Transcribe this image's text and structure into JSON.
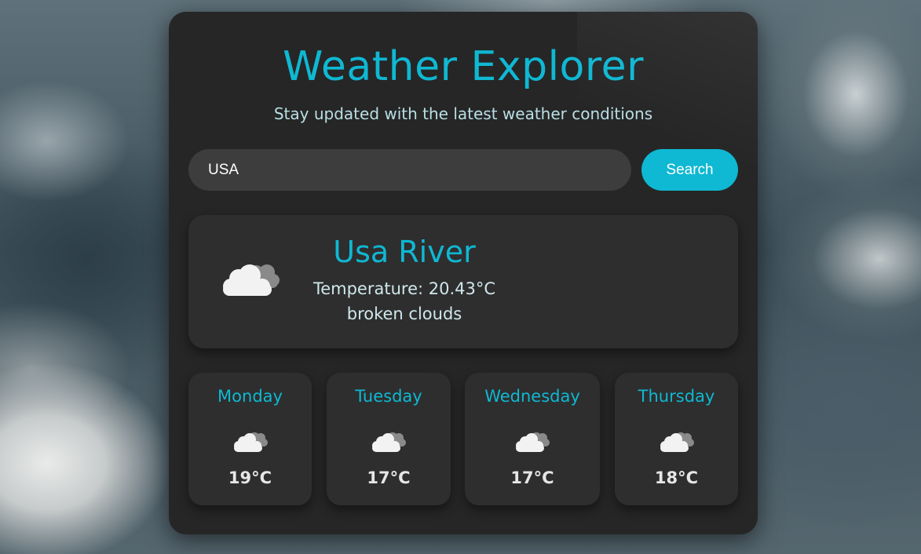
{
  "header": {
    "title": "Weather Explorer",
    "subtitle": "Stay updated with the latest weather conditions"
  },
  "search": {
    "value": "USA",
    "button_label": "Search"
  },
  "current": {
    "city": "Usa River",
    "temperature_text": "Temperature: 20.43°C",
    "description": "broken clouds",
    "icon": "broken-clouds-icon"
  },
  "forecast": [
    {
      "day": "Monday",
      "temp": "19°C",
      "icon": "broken-clouds-icon"
    },
    {
      "day": "Tuesday",
      "temp": "17°C",
      "icon": "broken-clouds-icon"
    },
    {
      "day": "Wednesday",
      "temp": "17°C",
      "icon": "broken-clouds-icon"
    },
    {
      "day": "Thursday",
      "temp": "18°C",
      "icon": "broken-clouds-icon"
    }
  ],
  "colors": {
    "accent": "#0fb8d3",
    "card": "#262626",
    "panel": "#2e2e2e",
    "input": "#3d3d3d"
  }
}
